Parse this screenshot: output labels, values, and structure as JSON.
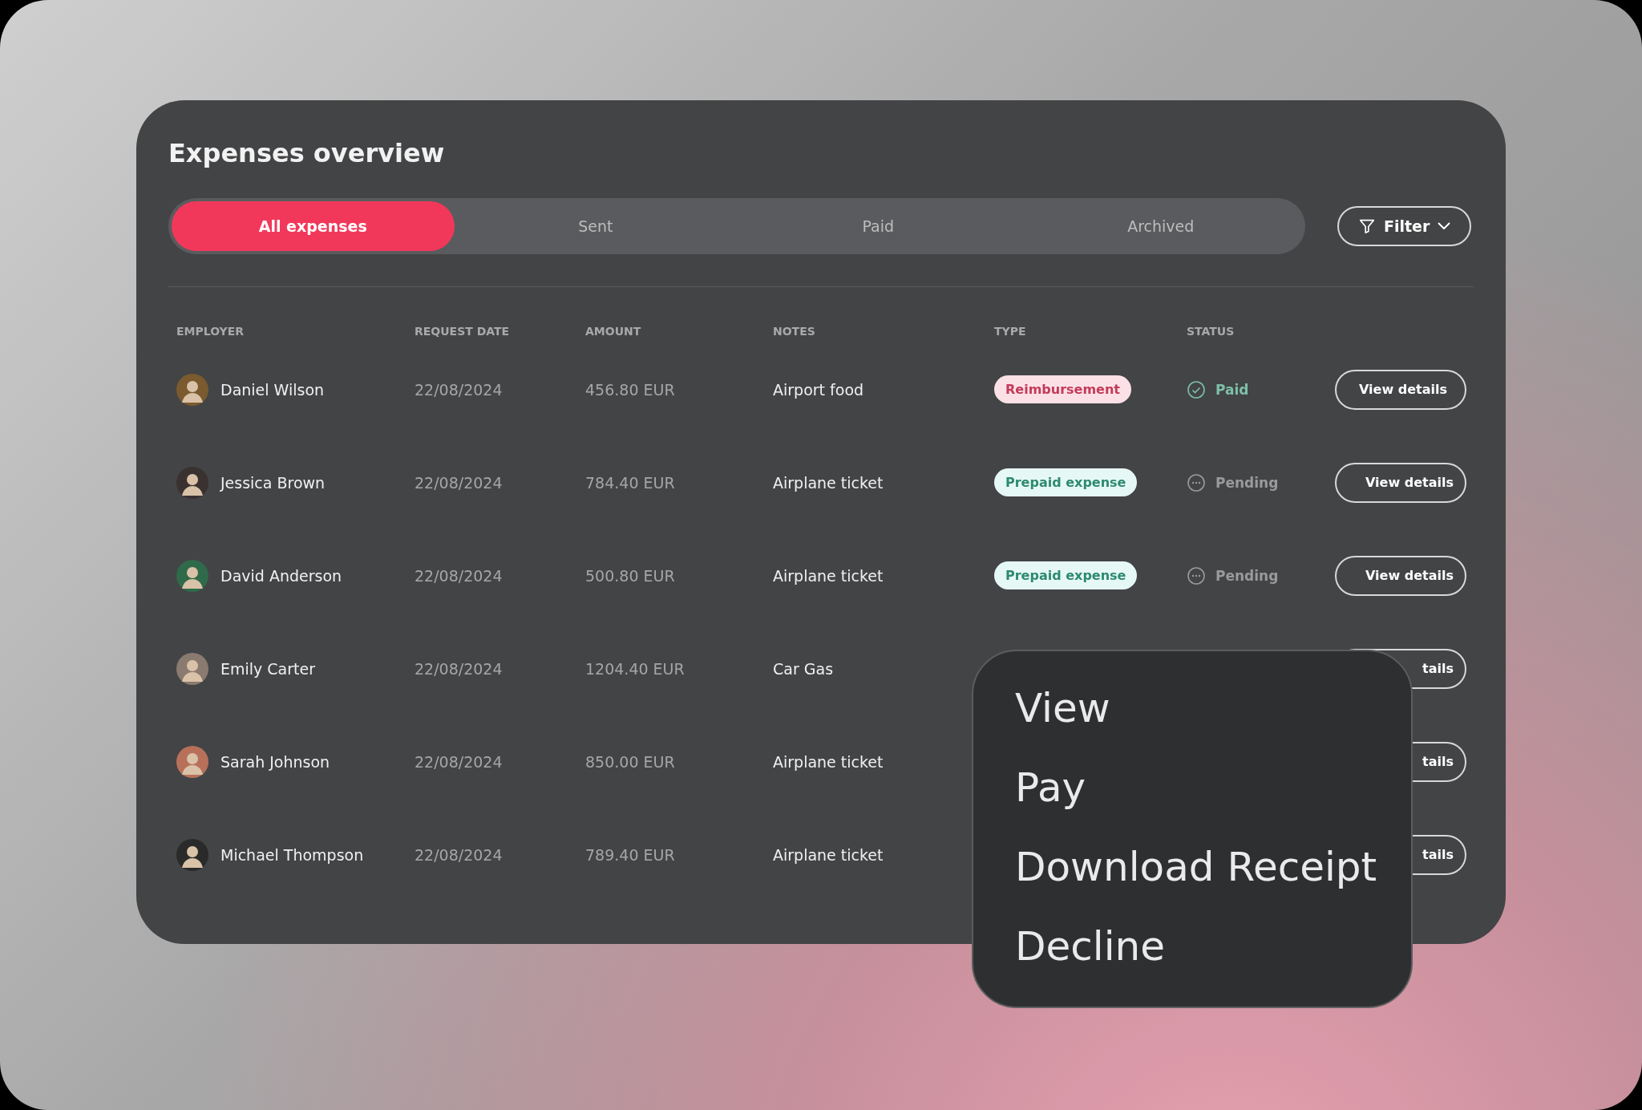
{
  "title": "Expenses overview",
  "tabs": [
    {
      "label": "All expenses",
      "selected": true
    },
    {
      "label": "Sent",
      "selected": false
    },
    {
      "label": "Paid",
      "selected": false
    },
    {
      "label": "Archived",
      "selected": false
    }
  ],
  "filter": {
    "label": "Filter"
  },
  "table": {
    "columns": [
      "EMPLOYER",
      "REQUEST DATE",
      "AMOUNT",
      "NOTES",
      "TYPE",
      "STATUS"
    ],
    "rows": [
      {
        "employer": "Daniel Wilson",
        "date": "22/08/2024",
        "amount": "456.80 EUR",
        "notes": "Airport food",
        "type": {
          "kind": "reimbursement",
          "label": "Reimbursement"
        },
        "status": {
          "kind": "paid",
          "label": "Paid"
        },
        "action": "View details"
      },
      {
        "employer": "Jessica Brown",
        "date": "22/08/2024",
        "amount": "784.40 EUR",
        "notes": "Airplane ticket",
        "type": {
          "kind": "prepaid",
          "label": "Prepaid expense"
        },
        "status": {
          "kind": "pending",
          "label": "Pending"
        },
        "action": "View details"
      },
      {
        "employer": "David Anderson",
        "date": "22/08/2024",
        "amount": "500.80 EUR",
        "notes": "Airplane ticket",
        "type": {
          "kind": "prepaid",
          "label": "Prepaid expense"
        },
        "status": {
          "kind": "pending",
          "label": "Pending"
        },
        "action": "View details"
      },
      {
        "employer": "Emily Carter",
        "date": "22/08/2024",
        "amount": "1204.40 EUR",
        "notes": "Car Gas",
        "action": "tails"
      },
      {
        "employer": "Sarah Johnson",
        "date": "22/08/2024",
        "amount": "850.00 EUR",
        "notes": "Airplane ticket",
        "action": "tails"
      },
      {
        "employer": "Michael Thompson",
        "date": "22/08/2024",
        "amount": "789.40 EUR",
        "notes": "Airplane ticket",
        "action": "tails"
      }
    ]
  },
  "context_menu": {
    "items": [
      "View",
      "Pay",
      "Download Receipt",
      "Decline"
    ]
  }
}
